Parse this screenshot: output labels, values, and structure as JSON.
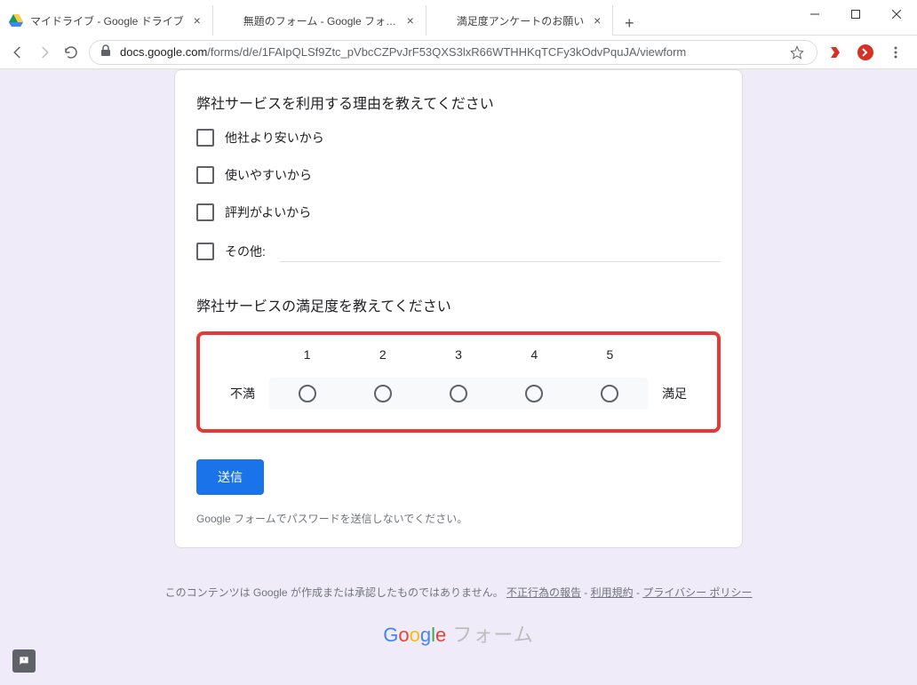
{
  "tabs": [
    {
      "title": "マイドライブ - Google ドライブ",
      "favicon": "drive"
    },
    {
      "title": "無題のフォーム - Google フォーム",
      "favicon": "forms"
    },
    {
      "title": "満足度アンケートのお願い",
      "favicon": "forms",
      "active": true
    }
  ],
  "url": {
    "host": "docs.google.com",
    "path": "/forms/d/e/1FAIpQLSf9Ztc_pVbcCZPvJrF53QXS3lxR66WTHHKqTCFy3kOdvPquJA/viewform"
  },
  "q1": {
    "title": "弊社サービスを利用する理由を教えてください",
    "options": [
      "他社より安いから",
      "使いやすいから",
      "評判がよいから"
    ],
    "other_label": "その他:"
  },
  "q2": {
    "title": "弊社サービスの満足度を教えてください",
    "low_label": "不満",
    "high_label": "満足",
    "scale": [
      "1",
      "2",
      "3",
      "4",
      "5"
    ]
  },
  "submit_label": "送信",
  "pw_note": "Google フォームでパスワードを送信しないでください。",
  "footer": {
    "text_prefix": "このコンテンツは Google が作成または承認したものではありません。",
    "link1": "不正行為の報告",
    "link2": "利用規約",
    "link3": "プライバシー ポリシー"
  },
  "logo_rest": " フォーム"
}
